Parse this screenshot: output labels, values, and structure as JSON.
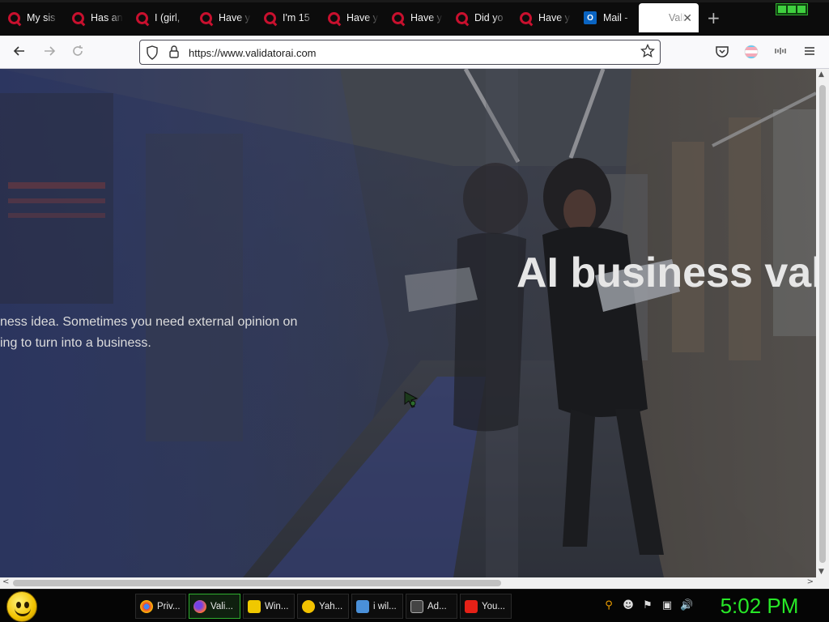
{
  "browser": {
    "tabs": [
      {
        "label": "My sis",
        "icon": "quora-icon"
      },
      {
        "label": "Has an",
        "icon": "quora-icon"
      },
      {
        "label": "I (girl,",
        "icon": "quora-icon"
      },
      {
        "label": "Have y",
        "icon": "quora-icon"
      },
      {
        "label": "I'm 15",
        "icon": "quora-icon"
      },
      {
        "label": "Have y",
        "icon": "quora-icon"
      },
      {
        "label": "Have y",
        "icon": "quora-icon"
      },
      {
        "label": "Did yo",
        "icon": "quora-icon"
      },
      {
        "label": "Have y",
        "icon": "quora-icon"
      },
      {
        "label": "Mail -",
        "icon": "outlook-icon"
      },
      {
        "label": "Vali",
        "icon": "blank-icon",
        "active": true
      }
    ],
    "outlook_glyph": "O",
    "new_tab_label": "+",
    "close_tab_label": "✕",
    "url": "https://www.validatorai.com"
  },
  "page": {
    "hero_title": "AI business val",
    "hero_text_line1": "ness idea. Sometimes you need external opinion on",
    "hero_text_line2": "ing to turn into a business."
  },
  "taskbar": {
    "items": [
      {
        "label": "Priv...",
        "icon": "chrome-icon",
        "color": "#4285f4"
      },
      {
        "label": "Vali...",
        "icon": "firefox-icon",
        "color": "#ff7139",
        "active": true
      },
      {
        "label": "Win...",
        "icon": "folder-icon",
        "color": "#f0c800"
      },
      {
        "label": "Yah...",
        "icon": "yahoo-messenger-icon",
        "color": "#f2c200"
      },
      {
        "label": "i wil...",
        "icon": "picture-icon",
        "color": "#4a90d9"
      },
      {
        "label": "Ad...",
        "icon": "cmd-icon",
        "color": "#444444"
      },
      {
        "label": "You...",
        "icon": "youtube-icon",
        "color": "#e62117"
      }
    ],
    "clock": "5:02 PM"
  },
  "colors": {
    "accent": "#27e827",
    "quora_red": "#c8102e"
  }
}
